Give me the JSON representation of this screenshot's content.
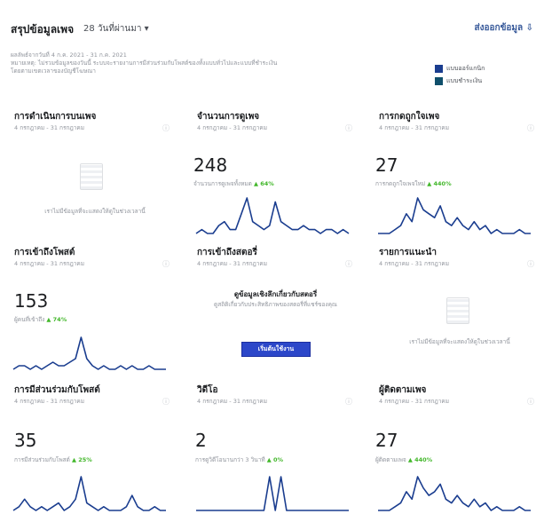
{
  "header": {
    "title": "สรุปข้อมูลเพจ",
    "period": "28 วันที่ผ่านมา ▾",
    "export_label": "ส่งออกข้อมูล ⇩"
  },
  "subinfo": {
    "line1": "ผลลัพธ์จากวันที่ 4 ก.ค. 2021 - 31 ก.ค. 2021",
    "line2": "หมายเหตุ: ไม่รวมข้อมูลของวันนี้ ระบบจะรายงานการมีส่วนร่วมกับโพสต์ของทั้งแบบทั่วไปและแบบที่ชำระเงิน",
    "line3": "โดยตามเขตเวลาของบัญชีโฆษณา"
  },
  "legend": [
    {
      "label": "แบบออร์แกนิก",
      "color": "#1a3d8f"
    },
    {
      "label": "แบบชำระเงิน",
      "color": "#0f4f6b"
    }
  ],
  "cards": {
    "actions": {
      "title": "การดำเนินการบนเพจ",
      "date": "4 กรกฎาคม - 31 กรกฎาคม",
      "empty_text": "เราไม่มีข้อมูลที่จะแสดงให้ดูในช่วงเวลานี้"
    },
    "views": {
      "title": "จำนวนการดูเพจ",
      "date": "4 กรกฎาคม - 31 กรกฎาคม",
      "value": "248",
      "subtext": "จำนวนการดูเพจทั้งหมด",
      "change": "▲ 64%",
      "series": [
        0,
        1,
        0,
        0,
        2,
        3,
        1,
        1,
        5,
        9,
        3,
        2,
        1,
        2,
        8,
        3,
        2,
        1,
        1,
        2,
        1,
        1,
        0,
        1,
        1,
        0,
        1,
        0
      ]
    },
    "likes": {
      "title": "การกดถูกใจเพจ",
      "date": "4 กรกฎาคม - 31 กรกฎาคม",
      "value": "27",
      "subtext": "การกดถูกใจเพจใหม่",
      "change": "▲ 440%",
      "series": [
        0,
        0,
        0,
        1,
        2,
        5,
        3,
        9,
        6,
        5,
        4,
        7,
        3,
        2,
        4,
        2,
        1,
        3,
        1,
        2,
        0,
        1,
        0,
        0,
        0,
        1,
        0,
        0
      ]
    },
    "post_reach": {
      "title": "การเข้าถึงโพสต์",
      "date": "4 กรกฎาคม - 31 กรกฎาคม",
      "value": "153",
      "subtext": "ผู้คนที่เข้าถึง",
      "change": "▲ 74%",
      "series": [
        0,
        1,
        1,
        0,
        1,
        0,
        1,
        2,
        1,
        1,
        2,
        3,
        9,
        3,
        1,
        0,
        1,
        0,
        0,
        1,
        0,
        1,
        0,
        0,
        1,
        0,
        0,
        0
      ]
    },
    "story_reach": {
      "title": "การเข้าถึงสตอรี่",
      "date": "4 กรกฎาคม - 31 กรกฎาคม",
      "promo_title": "ดูข้อมูลเชิงลึกเกี่ยวกับสตอรี่",
      "promo_text": "ดูสถิติเกี่ยวกับประสิทธิภาพของสตอรี่ที่แชร์ของคุณ",
      "button": "เริ่มต้นใช้งาน"
    },
    "recommendations": {
      "title": "รายการแนะนำ",
      "date": "4 กรกฎาคม - 31 กรกฎาคม",
      "empty_text": "เราไม่มีข้อมูลที่จะแสดงให้ดูในช่วงเวลานี้"
    },
    "engagement": {
      "title": "การมีส่วนร่วมกับโพสต์",
      "date": "4 กรกฎาคม - 31 กรกฎาคม",
      "value": "35",
      "subtext": "การมีส่วนร่วมกับโพสต์",
      "change": "▲ 25%",
      "series": [
        0,
        1,
        3,
        1,
        0,
        1,
        0,
        1,
        2,
        0,
        1,
        3,
        9,
        2,
        1,
        0,
        1,
        0,
        0,
        0,
        1,
        4,
        1,
        0,
        0,
        1,
        0,
        0
      ]
    },
    "videos": {
      "title": "วิดีโอ",
      "date": "4 กรกฎาคม - 31 กรกฎาคม",
      "value": "2",
      "subtext": "การดูวิดีโอนานกว่า 3 วินาที",
      "change": "▲ 0%",
      "series": [
        0,
        0,
        0,
        0,
        0,
        0,
        0,
        0,
        0,
        0,
        0,
        0,
        0,
        9,
        0,
        9,
        0,
        0,
        0,
        0,
        0,
        0,
        0,
        0,
        0,
        0,
        0,
        0
      ]
    },
    "followers": {
      "title": "ผู้ติดตามเพจ",
      "date": "4 กรกฎาคม - 31 กรกฎาคม",
      "value": "27",
      "subtext": "ผู้ติดตามเพจ",
      "change": "▲ 440%",
      "series": [
        0,
        0,
        0,
        1,
        2,
        5,
        3,
        9,
        6,
        4,
        5,
        7,
        3,
        2,
        4,
        2,
        1,
        3,
        1,
        2,
        0,
        1,
        0,
        0,
        0,
        1,
        0,
        0
      ]
    }
  }
}
